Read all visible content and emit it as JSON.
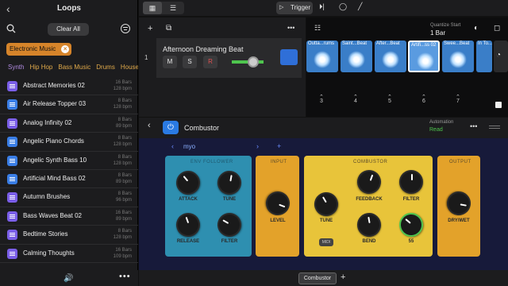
{
  "sidebar": {
    "title": "Loops",
    "clear_all": "Clear All",
    "filter_chip": "Electronic Music",
    "categories": [
      "Synth",
      "Hip Hop",
      "Bass Music",
      "Drums",
      "House"
    ],
    "loops": [
      {
        "name": "Abstract Memories 02",
        "meta1": "16 Bars",
        "meta2": "128 bpm",
        "icon": "purple"
      },
      {
        "name": "Air Release Topper 03",
        "meta1": "8 Bars",
        "meta2": "128 bpm",
        "icon": "blue"
      },
      {
        "name": "Analog Infinity 02",
        "meta1": "8 Bars",
        "meta2": "89 bpm",
        "icon": "purple"
      },
      {
        "name": "Angelic Piano Chords",
        "meta1": "8 Bars",
        "meta2": "128 bpm",
        "icon": "blue"
      },
      {
        "name": "Angelic Synth Bass 10",
        "meta1": "8 Bars",
        "meta2": "128 bpm",
        "icon": "blue"
      },
      {
        "name": "Artificial Mind Bass 02",
        "meta1": "8 Bars",
        "meta2": "89 bpm",
        "icon": "blue"
      },
      {
        "name": "Autumn Brushes",
        "meta1": "8 Bars",
        "meta2": "96 bpm",
        "icon": "purple"
      },
      {
        "name": "Bass Waves Beat 02",
        "meta1": "16 Bars",
        "meta2": "89 bpm",
        "icon": "purple"
      },
      {
        "name": "Bedtime Stories",
        "meta1": "8 Bars",
        "meta2": "128 bpm",
        "icon": "purple"
      },
      {
        "name": "Calming Thoughts",
        "meta1": "16 Bars",
        "meta2": "109 bpm",
        "icon": "purple"
      }
    ]
  },
  "toolbar": {
    "trigger": "Trigger"
  },
  "track": {
    "number": "1",
    "name": "Afternoon Dreaming Beat",
    "m": "M",
    "s": "S",
    "r": "R"
  },
  "quantize": {
    "label": "Quantize Start",
    "value": "1 Bar"
  },
  "cells": [
    "Outta...rums",
    "Saint...Beat",
    "After...Beat",
    "Artifi...ss 02",
    "Swee...Beat",
    "In To..."
  ],
  "scenes": [
    "3",
    "4",
    "5",
    "6",
    "7"
  ],
  "plugin": {
    "name": "Combustor",
    "automation_label": "Automation",
    "automation_value": "Read",
    "preset": "myo",
    "panels": {
      "env": "ENV FOLLOWER",
      "input": "INPUT",
      "combustor": "COMBUSTOR",
      "output": "OUTPUT"
    },
    "knobs": {
      "attack": "ATTACK",
      "tune1": "TUNE",
      "release": "RELEASE",
      "filter1": "FILTER",
      "level": "LEVEL",
      "tune2": "TUNE",
      "feedback": "FEEDBACK",
      "filter2": "FILTER",
      "bend": "BEND",
      "v55": "55",
      "drywet": "DRY/WET"
    },
    "midi": "MIDI",
    "tab": "Combustor"
  },
  "colors": {
    "accent": "#2a7ae2",
    "chip": "#d6842a",
    "env": "#2e8fb0",
    "comb": "#e8c43a"
  }
}
